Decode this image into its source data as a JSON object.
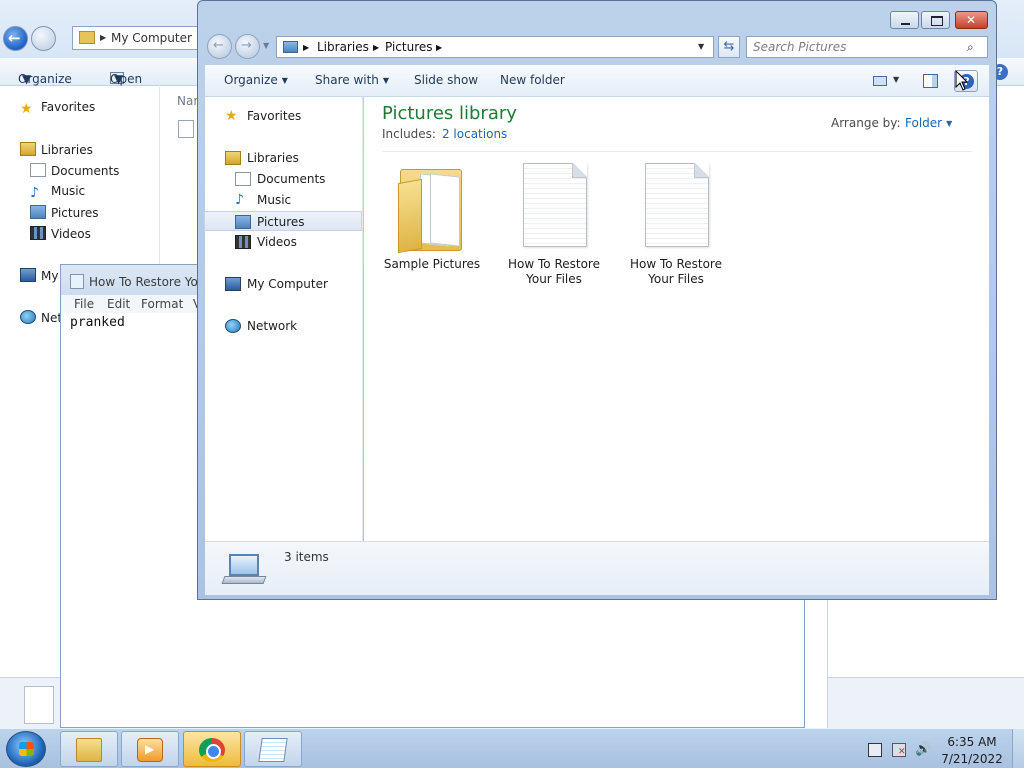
{
  "background_explorer": {
    "address": "My Computer",
    "toolbar": {
      "organize": "Organize",
      "open": "Open"
    },
    "column_name": "Nam",
    "nav": [
      {
        "label": "Favorites",
        "icon": "star-icon"
      },
      {
        "label": "Libraries",
        "icon": "libraries-icon"
      },
      {
        "label": "Documents",
        "icon": "documents-icon"
      },
      {
        "label": "Music",
        "icon": "music-icon"
      },
      {
        "label": "Pictures",
        "icon": "pictures-icon"
      },
      {
        "label": "Videos",
        "icon": "videos-icon"
      },
      {
        "label": "My",
        "icon": "computer-icon"
      },
      {
        "label": "Net",
        "icon": "network-icon"
      }
    ]
  },
  "notepad": {
    "title": "How To Restore You",
    "menu": [
      "File",
      "Edit",
      "Format",
      "V"
    ],
    "content": "pranked"
  },
  "explorer": {
    "breadcrumb": [
      "Libraries",
      "Pictures"
    ],
    "search_placeholder": "Search Pictures",
    "toolbar": {
      "organize": "Organize",
      "share_with": "Share with",
      "slide_show": "Slide show",
      "new_folder": "New folder"
    },
    "nav": {
      "favorites": "Favorites",
      "libraries": "Libraries",
      "documents": "Documents",
      "music": "Music",
      "pictures": "Pictures",
      "videos": "Videos",
      "my_computer": "My Computer",
      "network": "Network"
    },
    "library": {
      "title": "Pictures library",
      "includes_label": "Includes:",
      "locations": "2 locations",
      "arrange_by_label": "Arrange by:",
      "arrange_by_value": "Folder"
    },
    "items": [
      {
        "line1": "Sample Pictures",
        "line2": "",
        "kind": "folder"
      },
      {
        "line1": "How To Restore",
        "line2": "Your Files",
        "kind": "text-file"
      },
      {
        "line1": "How To Restore",
        "line2": "Your Files",
        "kind": "text-file"
      }
    ],
    "details": {
      "count": "3 items"
    }
  },
  "taskbar": {
    "buttons": [
      {
        "name": "windows-explorer",
        "icon": "folder-icon",
        "active": false
      },
      {
        "name": "media-player",
        "icon": "media-player-icon",
        "active": false
      },
      {
        "name": "chrome",
        "icon": "chrome-icon",
        "active": true
      },
      {
        "name": "notepad",
        "icon": "notepad-icon",
        "active": false
      }
    ],
    "time": "6:35 AM",
    "date": "7/21/2022"
  },
  "colors": {
    "library_title": "#1e7a34",
    "link": "#1a66b5",
    "close_button": "#c4412b"
  }
}
